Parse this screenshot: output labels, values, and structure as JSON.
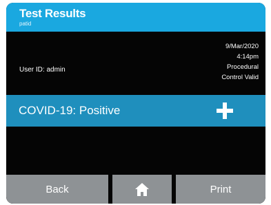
{
  "header": {
    "title": "Test Results",
    "subtitle": "patid"
  },
  "info": {
    "user_id": "User ID: admin",
    "date": "9/Mar/2020",
    "time": "4:14pm",
    "procedural": "Procedural",
    "control_valid": "Control Valid"
  },
  "result": {
    "label": "COVID-19: Positive",
    "icon": "plus-icon"
  },
  "footer": {
    "back_label": "Back",
    "home_icon": "home-icon",
    "print_label": "Print"
  },
  "colors": {
    "titlebar": "#1aa8e0",
    "result_row": "#1f8fbd",
    "button": "#8e9295",
    "background": "#050505"
  }
}
